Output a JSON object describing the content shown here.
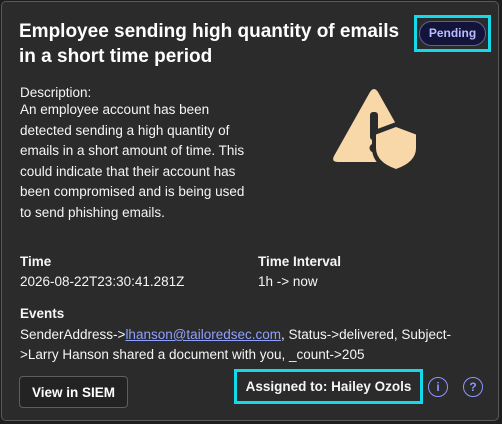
{
  "alert": {
    "title": "Employee sending high quantity of emails in a short time period",
    "status": "Pending",
    "description_label": "Description:",
    "description": "An employee account has been detected sending a high quantity of emails in a short amount of time. This could indicate that their account has been compromised and is being used to send phishing emails.",
    "icon": "warning-shield-icon"
  },
  "details": {
    "time_label": "Time",
    "time_value": "2026-08-22T23:30:41.281Z",
    "interval_label": "Time Interval",
    "interval_value": "1h -> now"
  },
  "events": {
    "label": "Events",
    "prefix": "SenderAddress->",
    "email_link": "lhanson@tailoredsec.com",
    "suffix": ", Status->delivered, Subject->Larry Hanson shared a document with you, _count->205"
  },
  "footer": {
    "siem_button": "View in SIEM",
    "assigned": "Assigned to: Hailey Ozols",
    "info_icon_glyph": "i",
    "help_icon_glyph": "?"
  },
  "colors": {
    "accent_highlight": "#14d9eb",
    "link": "#8fa0ff",
    "icon_fill": "#f8d8a8",
    "badge_text": "#b6bcff"
  }
}
